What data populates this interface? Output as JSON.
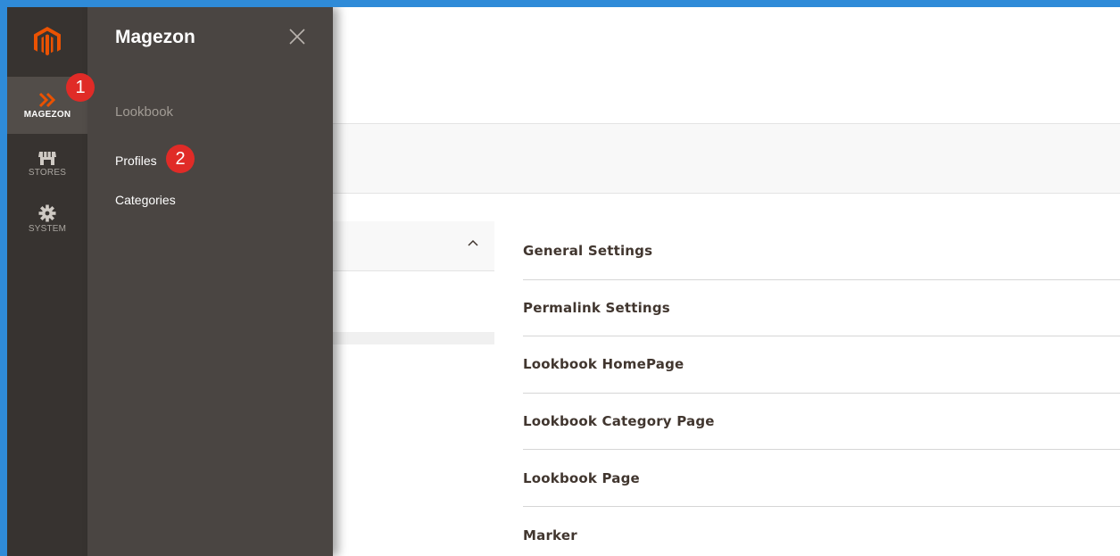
{
  "nav": {
    "items": [
      {
        "label": "MAGEZON",
        "icon": "magezon-chevrons-icon",
        "active": true
      },
      {
        "label": "STORES",
        "icon": "store-icon",
        "active": false
      },
      {
        "label": "SYSTEM",
        "icon": "gear-icon",
        "active": false
      }
    ]
  },
  "annotations": {
    "step1": "1",
    "step2": "2"
  },
  "submenu": {
    "title": "Magezon",
    "section": "Lookbook",
    "links": [
      "Profiles",
      "Categories"
    ]
  },
  "settings": {
    "items": [
      "General Settings",
      "Permalink Settings",
      "Lookbook HomePage",
      "Lookbook Category Page",
      "Lookbook Page",
      "Marker"
    ]
  },
  "colors": {
    "frame": "#2f8bd8",
    "nav_bg": "#373330",
    "submenu_bg": "#4a4542",
    "logo_orange": "#eb5202",
    "badge_red": "#e02b27"
  }
}
